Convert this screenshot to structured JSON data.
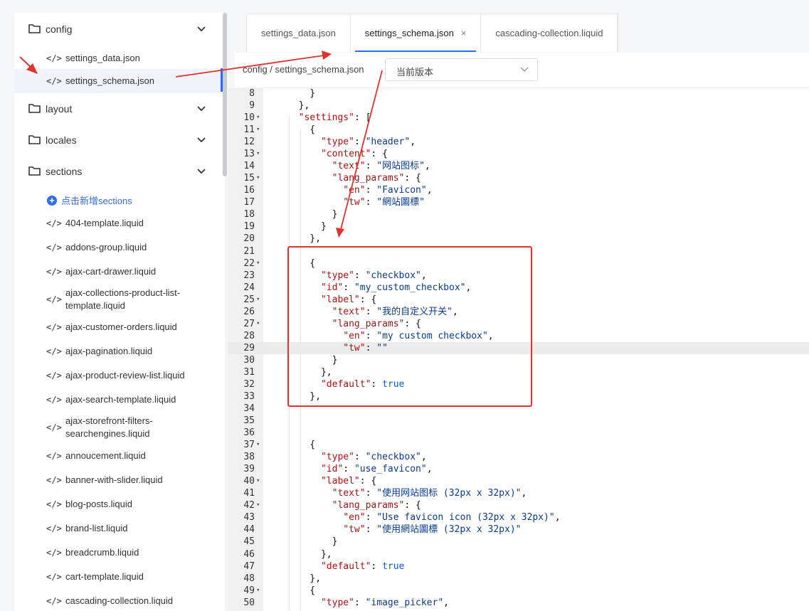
{
  "sidebar": {
    "folders": {
      "config": "config",
      "layout": "layout",
      "locales": "locales",
      "sections": "sections"
    },
    "config_files": [
      "settings_data.json",
      "settings_schema.json"
    ],
    "add_sections_label": "点击新增sections",
    "section_files": [
      "404-template.liquid",
      "addons-group.liquid",
      "ajax-cart-drawer.liquid",
      "ajax-collections-product-list-template.liquid",
      "ajax-customer-orders.liquid",
      "ajax-pagination.liquid",
      "ajax-product-review-list.liquid",
      "ajax-search-template.liquid",
      "ajax-storefront-filters-searchengines.liquid",
      "annoucement.liquid",
      "banner-with-slider.liquid",
      "blog-posts.liquid",
      "brand-list.liquid",
      "breadcrumb.liquid",
      "cart-template.liquid",
      "cascading-collection.liquid"
    ],
    "icons": {
      "folder": "folder-icon",
      "chevron": "chevron-down-icon",
      "code": "code-icon"
    }
  },
  "tabs": [
    {
      "label": "settings_data.json"
    },
    {
      "label": "settings_schema.json",
      "close": "×"
    },
    {
      "label": "cascading-collection.liquid"
    }
  ],
  "breadcrumb": "config / settings_schema.json",
  "version_select": {
    "value": "当前版本"
  },
  "code_lines": [
    {
      "n": "8",
      "fold": "",
      "code": "    }"
    },
    {
      "n": "9",
      "fold": "",
      "code": "  },"
    },
    {
      "n": "10",
      "fold": "▾",
      "code": "  \"settings\": ["
    },
    {
      "n": "11",
      "fold": "▾",
      "code": "    {"
    },
    {
      "n": "12",
      "fold": "",
      "code": "      \"type\": \"header\","
    },
    {
      "n": "13",
      "fold": "▾",
      "code": "      \"content\": {"
    },
    {
      "n": "14",
      "fold": "",
      "code": "        \"text\": \"网站图标\","
    },
    {
      "n": "15",
      "fold": "▾",
      "code": "        \"lang_params\": {"
    },
    {
      "n": "16",
      "fold": "",
      "code": "          \"en\": \"Favicon\","
    },
    {
      "n": "17",
      "fold": "",
      "code": "          \"tw\": \"網站圖標\""
    },
    {
      "n": "18",
      "fold": "",
      "code": "        }"
    },
    {
      "n": "19",
      "fold": "",
      "code": "      }"
    },
    {
      "n": "20",
      "fold": "",
      "code": "    },"
    },
    {
      "n": "21",
      "fold": "",
      "code": ""
    },
    {
      "n": "22",
      "fold": "▾",
      "code": "    {"
    },
    {
      "n": "23",
      "fold": "",
      "code": "      \"type\": \"checkbox\","
    },
    {
      "n": "24",
      "fold": "",
      "code": "      \"id\": \"my_custom_checkbox\","
    },
    {
      "n": "25",
      "fold": "▾",
      "code": "      \"label\": {"
    },
    {
      "n": "26",
      "fold": "",
      "code": "        \"text\": \"我的自定义开关\","
    },
    {
      "n": "27",
      "fold": "▾",
      "code": "        \"lang_params\": {"
    },
    {
      "n": "28",
      "fold": "",
      "code": "          \"en\": \"my custom checkbox\","
    },
    {
      "n": "29",
      "fold": "",
      "code": "          \"tw\": \"\""
    },
    {
      "n": "30",
      "fold": "",
      "code": "        }"
    },
    {
      "n": "31",
      "fold": "",
      "code": "      },"
    },
    {
      "n": "32",
      "fold": "",
      "code": "      \"default\": true"
    },
    {
      "n": "33",
      "fold": "",
      "code": "    },"
    },
    {
      "n": "34",
      "fold": "",
      "code": ""
    },
    {
      "n": "35",
      "fold": "",
      "code": ""
    },
    {
      "n": "36",
      "fold": "",
      "code": ""
    },
    {
      "n": "37",
      "fold": "▾",
      "code": "    {"
    },
    {
      "n": "38",
      "fold": "",
      "code": "      \"type\": \"checkbox\","
    },
    {
      "n": "39",
      "fold": "",
      "code": "      \"id\": \"use_favicon\","
    },
    {
      "n": "40",
      "fold": "▾",
      "code": "      \"label\": {"
    },
    {
      "n": "41",
      "fold": "",
      "code": "        \"text\": \"使用网站图标 (32px x 32px)\","
    },
    {
      "n": "42",
      "fold": "▾",
      "code": "        \"lang_params\": {"
    },
    {
      "n": "43",
      "fold": "",
      "code": "          \"en\": \"Use favicon icon (32px x 32px)\","
    },
    {
      "n": "44",
      "fold": "",
      "code": "          \"tw\": \"使用網站圖標 (32px x 32px)\""
    },
    {
      "n": "45",
      "fold": "",
      "code": "        }"
    },
    {
      "n": "46",
      "fold": "",
      "code": "      },"
    },
    {
      "n": "47",
      "fold": "",
      "code": "      \"default\": true"
    },
    {
      "n": "48",
      "fold": "",
      "code": "    },"
    },
    {
      "n": "49",
      "fold": "▾",
      "code": "    {"
    },
    {
      "n": "50",
      "fold": "",
      "code": "      \"type\": \"image_picker\","
    }
  ],
  "highlighted_line": "29",
  "colors": {
    "accent": "#2f6ee7",
    "annotation": "#e0332d"
  }
}
